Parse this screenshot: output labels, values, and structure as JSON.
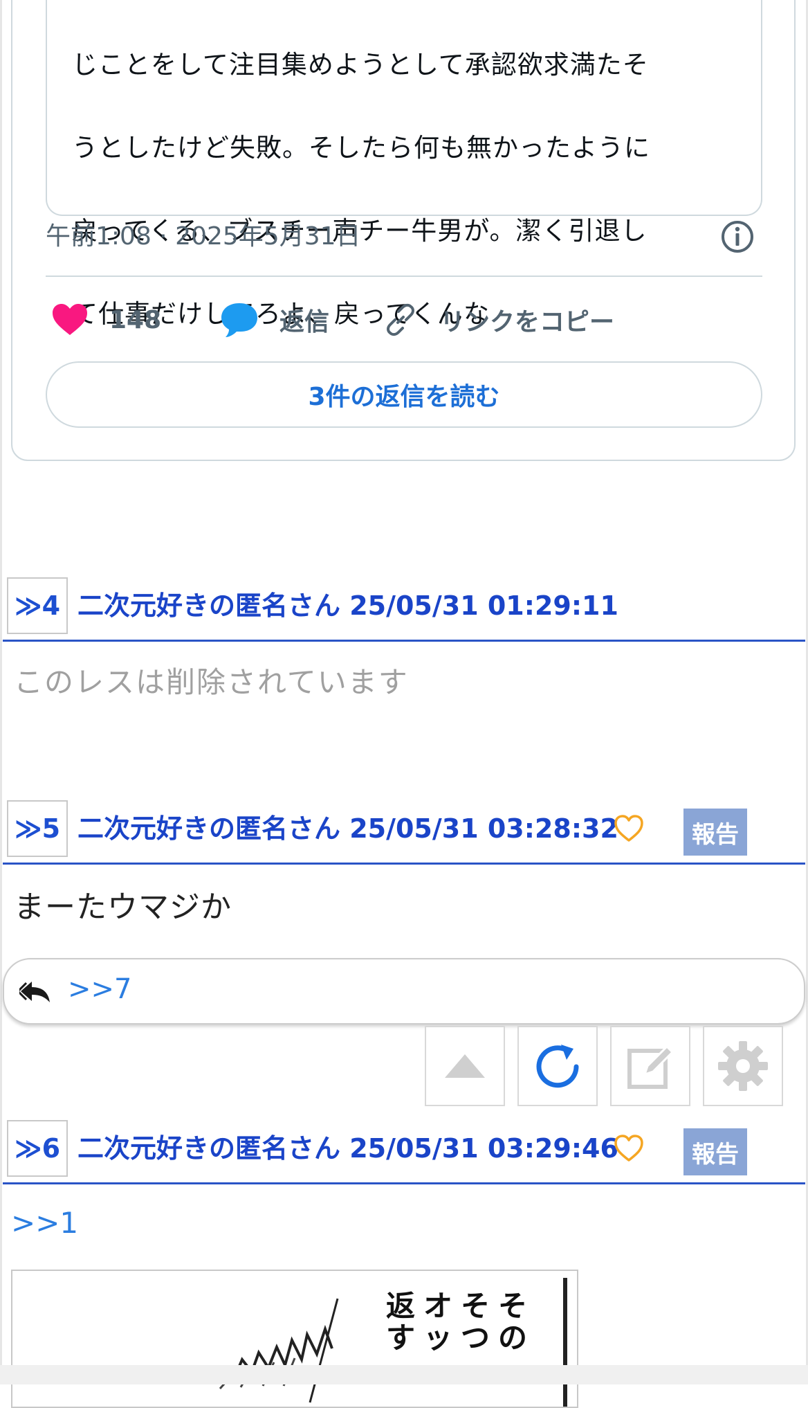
{
  "embedded_tweet": {
    "quote_lines": [
      "じことをして注目集めようとして承認欲求満たそ",
      "うとしたけど失敗。そしたら何も無かったように",
      "戻ってくる、ブスチー声チー牛男が。潔く引退し",
      "て仕事だけしてろよ、戻ってくんな"
    ],
    "timestamp": "午前1:08 · 2025年5月31日",
    "like_count": "148",
    "reply_label": "返信",
    "copy_link_label": "リンクをコピー",
    "read_replies_label": "3件の返信を読む",
    "colors": {
      "like": "#f91880",
      "reply": "#1d9bf0",
      "link": "#1d6fd6"
    }
  },
  "posts": [
    {
      "number": "≫4",
      "meta": "二次元好きの匿名さん 25/05/31 01:29:11",
      "deleted_text": "このレスは削除されています"
    },
    {
      "number": "≫5",
      "meta": "二次元好きの匿名さん 25/05/31 03:28:32",
      "report_label": "報告",
      "body": "まーたウマジか",
      "reply_links": [
        ">>7"
      ]
    },
    {
      "number": "≫6",
      "meta": "二次元好きの匿名さん 25/05/31 03:29:46",
      "report_label": "報告",
      "body_link": ">>1",
      "image_text": [
        "返す",
        "オッ",
        "そつ",
        "その"
      ]
    }
  ],
  "toolbar": {
    "icons": [
      "scroll-up-icon",
      "reload-icon",
      "edit-icon",
      "settings-icon"
    ]
  },
  "colors": {
    "post_accent": "#2a54c6",
    "report_bg": "#8aa5d6",
    "heart_outline": "#f5a623"
  }
}
